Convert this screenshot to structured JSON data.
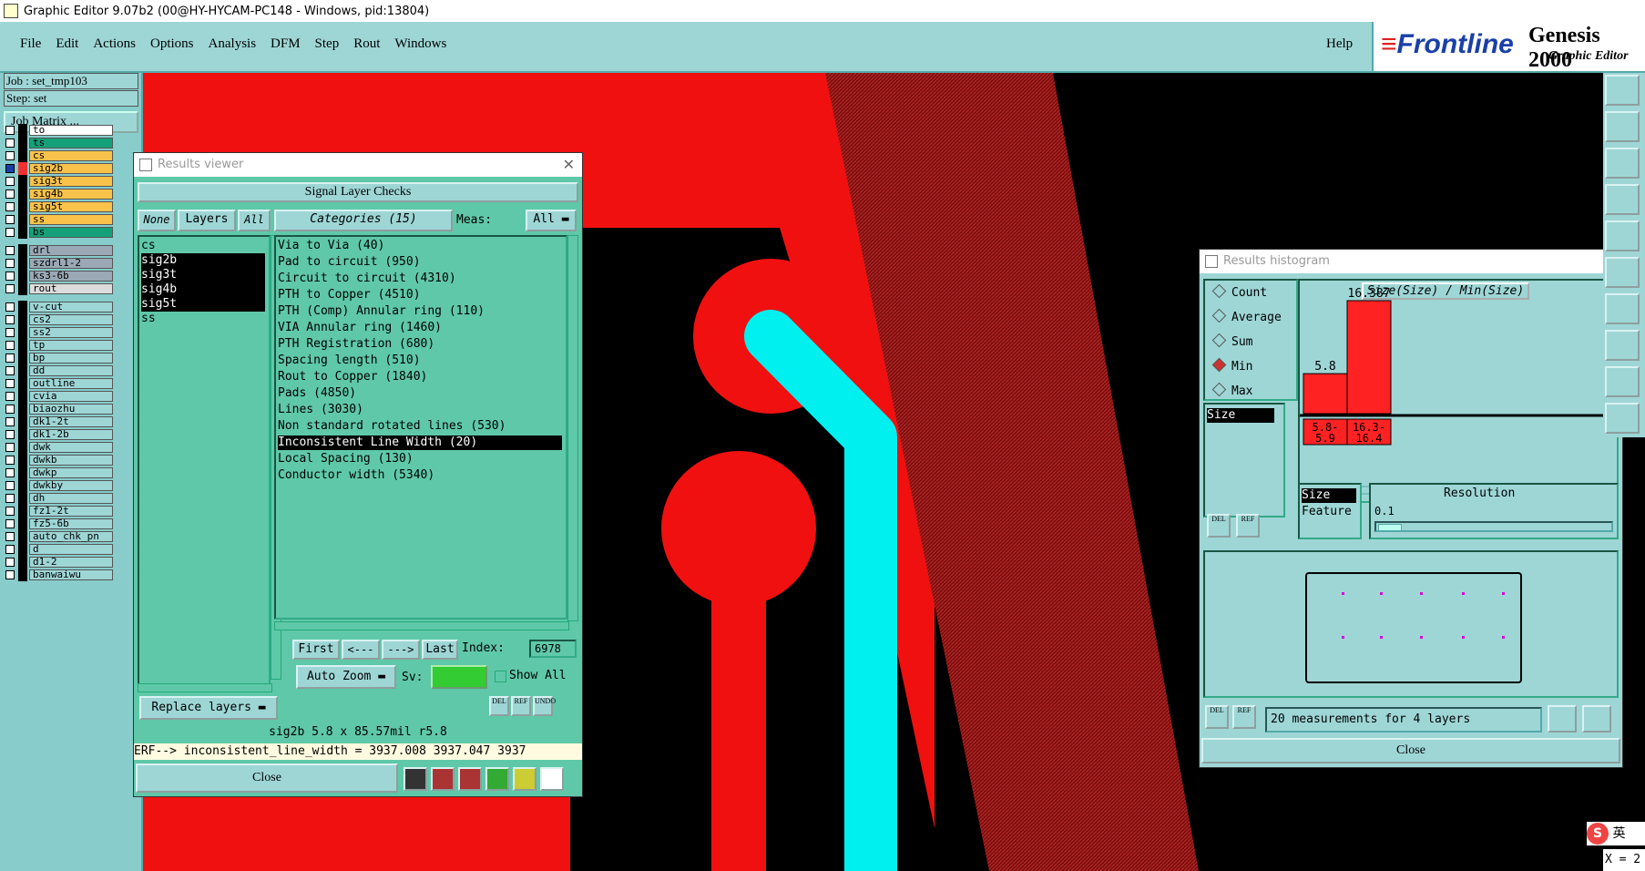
{
  "window": {
    "title": "Graphic Editor 9.07b2 (00@HY-HYCAM-PC148 - Windows, pid:13804)"
  },
  "menu": {
    "items": [
      "File",
      "Edit",
      "Actions",
      "Options",
      "Analysis",
      "DFM",
      "Step",
      "Rout",
      "Windows"
    ],
    "help": "Help"
  },
  "brand": {
    "logo": "Frontline",
    "product": "Genesis 2000",
    "subtitle": "Graphic Editor"
  },
  "job": {
    "job_line": "Job : set_tmp103",
    "step_line": "Step: set",
    "matrix_button": "Job Matrix ..."
  },
  "layers": [
    {
      "name": "to",
      "color": "#ffffff"
    },
    {
      "name": "ts",
      "color": "#14a078"
    },
    {
      "name": "cs",
      "color": "#f9c24a"
    },
    {
      "name": "sig2b",
      "color": "#f9c24a"
    },
    {
      "name": "sig3t",
      "color": "#f9c24a"
    },
    {
      "name": "sig4b",
      "color": "#f9c24a"
    },
    {
      "name": "sig5t",
      "color": "#f9c24a"
    },
    {
      "name": "ss",
      "color": "#f9c24a"
    },
    {
      "name": "bs",
      "color": "#14a078"
    },
    {
      "name": "drl",
      "color": "#9ba9b6"
    },
    {
      "name": "szdrl1-2",
      "color": "#9ba9b6"
    },
    {
      "name": "ks3-6b",
      "color": "#9ba9b6"
    },
    {
      "name": "rout",
      "color": "#dcdcdc"
    },
    {
      "name": "v-cut",
      "color": "#9ed6d6"
    },
    {
      "name": "cs2",
      "color": "#9ed6d6"
    },
    {
      "name": "ss2",
      "color": "#9ed6d6"
    },
    {
      "name": "tp",
      "color": "#9ed6d6"
    },
    {
      "name": "bp",
      "color": "#9ed6d6"
    },
    {
      "name": "dd",
      "color": "#9ed6d6"
    },
    {
      "name": "outline",
      "color": "#9ed6d6"
    },
    {
      "name": "cvia",
      "color": "#9ed6d6"
    },
    {
      "name": "biaozhu",
      "color": "#9ed6d6"
    },
    {
      "name": "dk1-2t",
      "color": "#9ed6d6"
    },
    {
      "name": "dk1-2b",
      "color": "#9ed6d6"
    },
    {
      "name": "dwk",
      "color": "#9ed6d6"
    },
    {
      "name": "dwkb",
      "color": "#9ed6d6"
    },
    {
      "name": "dwkp",
      "color": "#9ed6d6"
    },
    {
      "name": "dwkby",
      "color": "#9ed6d6"
    },
    {
      "name": "dh",
      "color": "#9ed6d6"
    },
    {
      "name": "fz1-2t",
      "color": "#9ed6d6"
    },
    {
      "name": "fz5-6b",
      "color": "#9ed6d6"
    },
    {
      "name": "auto_chk_pn",
      "color": "#9ed6d6"
    },
    {
      "name": "d",
      "color": "#9ed6d6"
    },
    {
      "name": "d1-2",
      "color": "#9ed6d6"
    },
    {
      "name": "banwaiwu",
      "color": "#9ed6d6"
    }
  ],
  "results_viewer": {
    "title": "Results viewer",
    "header": "Signal Layer Checks",
    "btn_none": "None",
    "btn_layers": "Layers",
    "btn_all": "All",
    "categories_label": "Categories (15)",
    "meas_label": "Meas:",
    "meas_value": "All",
    "layers": [
      "cs",
      "sig2b",
      "sig3t",
      "sig4b",
      "sig5t",
      "ss"
    ],
    "categories": [
      "Via to Via (40)",
      "Pad to circuit (950)",
      "Circuit to circuit (4310)",
      "PTH to Copper (4510)",
      "PTH (Comp) Annular ring (110)",
      "VIA Annular ring (1460)",
      "PTH Registration (680)",
      "Spacing length (510)",
      "Rout to Copper (1840)",
      "Pads (4850)",
      "Lines (3030)",
      "Non standard rotated lines (530)",
      "Inconsistent Line Width (20)",
      "Local Spacing (130)",
      "Conductor width (5340)"
    ],
    "nav": {
      "first": "First",
      "prev": "<---",
      "next": "--->",
      "last": "Last",
      "index_label": "Index:",
      "index_value": "6978"
    },
    "auto_zoom": "Auto Zoom",
    "sv_label": "Sv:",
    "show_all": "Show All",
    "replace_layers": "Replace layers",
    "del": "DEL",
    "ref": "REF",
    "undo": "UNDO",
    "status": "sig2b 5.8 x 85.57mil  r5.8",
    "erf": "ERF--> inconsistent_line_width = 3937.008 3937.047 3937",
    "close": "Close"
  },
  "histogram": {
    "title": "Results histogram",
    "modes": [
      "Count",
      "Average",
      "Sum",
      "Min",
      "Max"
    ],
    "selected_mode": "Min",
    "field": "Size",
    "chart_title": "Size(Size) / Min(Size)",
    "bars": [
      {
        "label": "5.8-\n5.9",
        "value": 5.8
      },
      {
        "label": "16.3-\n16.4",
        "value": 16.387
      }
    ],
    "bar_value_labels": [
      "5.8",
      "16.387"
    ],
    "attrs": [
      "Size",
      "Feature"
    ],
    "resolution_label": "Resolution",
    "resolution_value": "0.1",
    "summary": "20 measurements for 4 layers",
    "close": "Close",
    "del": "DEL",
    "ref": "REF"
  },
  "ime": {
    "label": "英"
  },
  "coords": {
    "label": "X = 2"
  }
}
